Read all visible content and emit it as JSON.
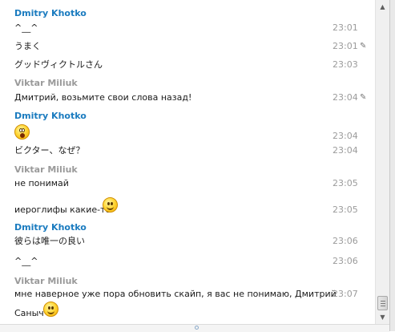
{
  "messages": [
    {
      "sender": "Dmitry Khotko",
      "sender_style": "blue"
    },
    {
      "text": "^__^",
      "time": "23:01"
    },
    {
      "text": "うまく",
      "time": "23:01",
      "edited": true
    },
    {
      "text": "グッドヴィクトルさん",
      "time": "23:03"
    },
    {
      "sender": "Viktar Miliuk",
      "sender_style": "gray"
    },
    {
      "text": "Дмитрий, возьмите свои слова назад!",
      "time": "23:04",
      "edited": true
    },
    {
      "sender": "Dmitry Khotko",
      "sender_style": "blue"
    },
    {
      "emoji": "surprised-emoji",
      "time": "23:04"
    },
    {
      "text": "ビクター、なぜ？",
      "time": "23:04"
    },
    {
      "sender": "Viktar Miliuk",
      "sender_style": "gray"
    },
    {
      "text": "не понимай",
      "time": "23:05"
    },
    {
      "text": "иероглифы какие-то",
      "emoji": "smile-emoji",
      "time": "23:05"
    },
    {
      "sender": "Dmitry Khotko",
      "sender_style": "blue"
    },
    {
      "text": "彼らは唯一の良い",
      "time": "23:06"
    },
    {
      "text": "^__^",
      "time": "23:06"
    },
    {
      "sender": "Viktar Miliuk",
      "sender_style": "gray"
    },
    {
      "text": "мне наверное уже пора обновить скайп, я вас не понимаю, Дмитрий",
      "time": "23:07"
    },
    {
      "text": "Саныч",
      "emoji": "smile-emoji"
    }
  ],
  "edited_mark": "✎",
  "colors": {
    "sender_blue": "#1a7bbf",
    "sender_gray": "#9a9a9a",
    "time": "#9b9b9b"
  }
}
